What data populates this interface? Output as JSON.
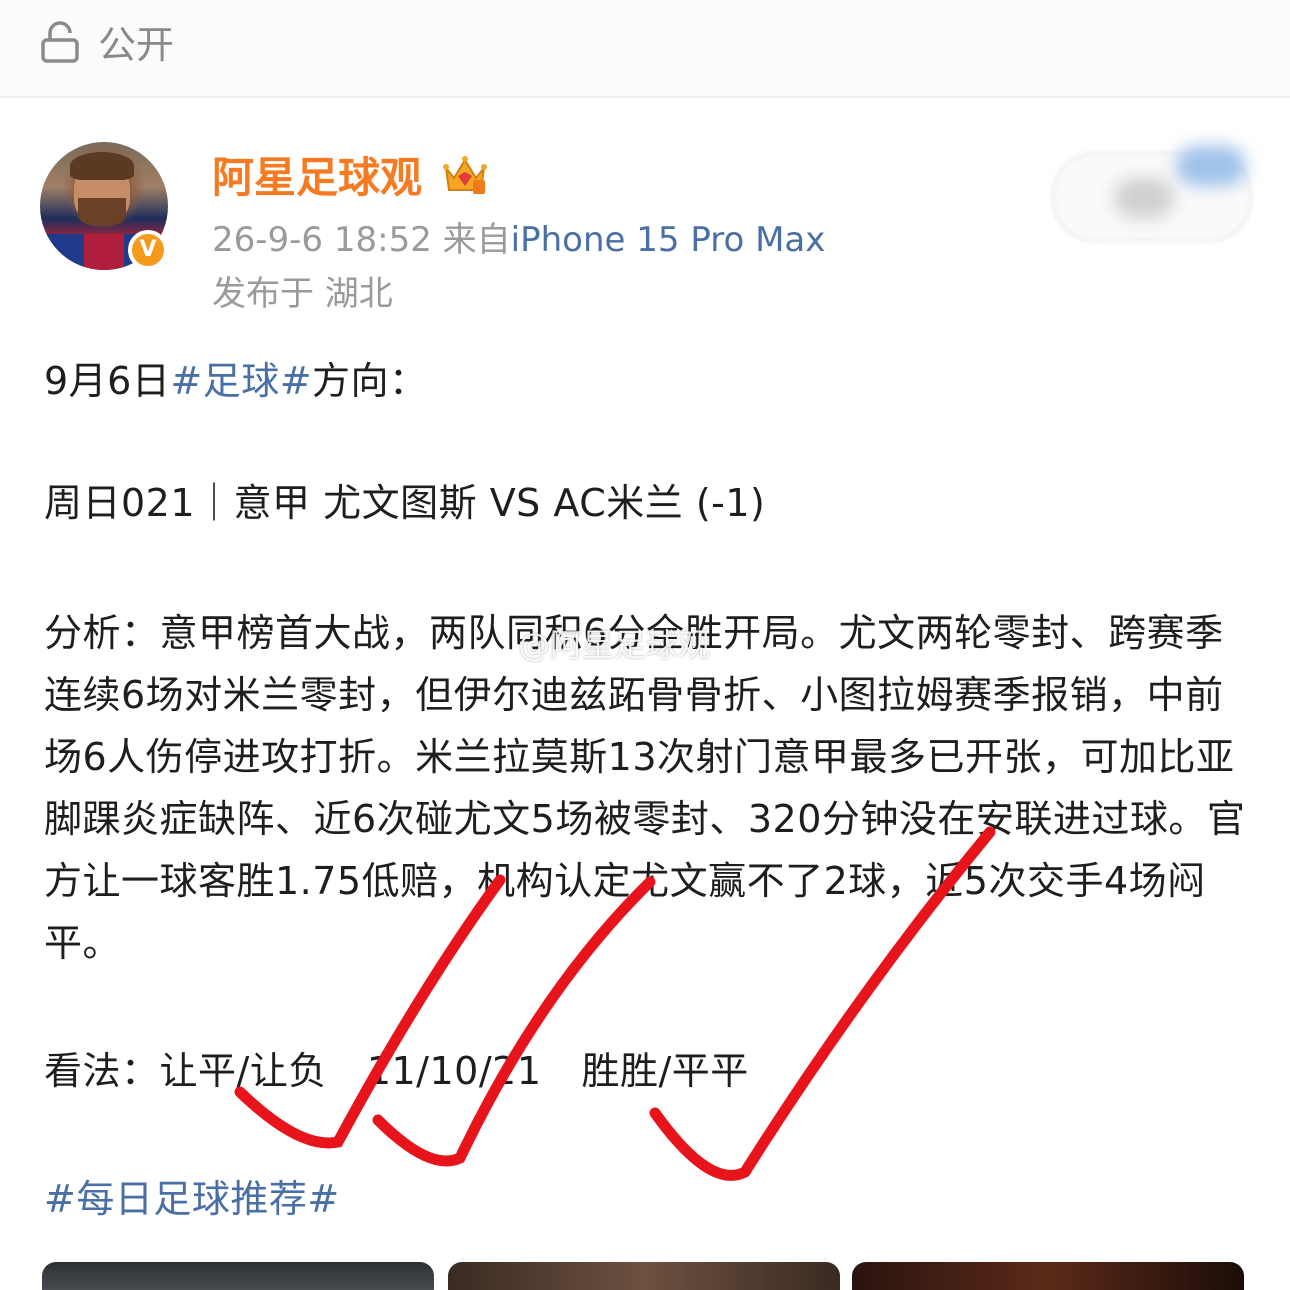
{
  "privacy": {
    "icon": "lock-icon",
    "label": "公开"
  },
  "author": {
    "name": "阿星足球观",
    "verified_badge": "V",
    "crown_icon": "crown-icon",
    "time": "26-9-6 18:52",
    "source_prefix": "来自",
    "device": "iPhone 15 Pro Max",
    "location": "发布于 湖北"
  },
  "post": {
    "line1_prefix": "9月6日",
    "line1_tag": "#足球#",
    "line1_suffix": "方向：",
    "match": "周日021｜意甲 尤文图斯 VS AC米兰 (-1)",
    "analysis": "分析：意甲榜首大战，两队同积6分全胜开局。尤文两轮零封、跨赛季连续6场对米兰零封，但伊尔迪兹跖骨骨折、小图拉姆赛季报销，中前场6人伤停进攻打折。米兰拉莫斯13次射门意甲最多已开张，可加比亚脚踝炎症缺阵、近6次碰尤文5场被零封、320分钟没在安联进过球。官方让一球客胜1.75低赔，机构认定尤文赢不了2球，近5次交手4场闷平。",
    "view_label": "看法：",
    "view_picks": "让平/让负",
    "view_scores": "11/10/21",
    "view_halftime": "胜胜/平平",
    "footer_tag": "#每日足球推荐#"
  },
  "watermark": "@阿星足球观",
  "colors": {
    "accent_name": "#f57a22",
    "link": "#4a6fa5",
    "check_mark": "#e8141c",
    "muted": "#9a9a9a"
  }
}
